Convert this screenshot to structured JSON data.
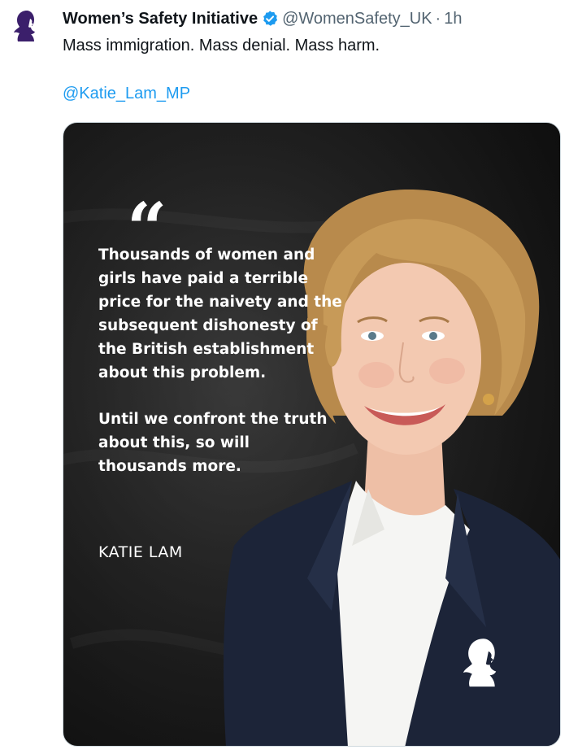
{
  "tweet": {
    "author": {
      "display_name": "Women’s Safety Initiative",
      "handle": "@WomenSafety_UK",
      "verified": true,
      "avatar_icon": "silhouette-woman-icon"
    },
    "separator": "·",
    "time": "1h",
    "text": "Mass immigration. Mass denial. Mass harm.",
    "mention": "@Katie_Lam_MP"
  },
  "media": {
    "quote_mark": "“",
    "quote_paragraphs": [
      "Thousands of women and girls have paid a terrible price for the naivety and the subsequent dishonesty of the British establishment about this problem.",
      "Until we confront the truth about this, so will thousands more."
    ],
    "attribution": "KATIE LAM",
    "logo_icon": "silhouette-woman-icon"
  },
  "colors": {
    "accent": "#1d9bf0",
    "text_primary": "#0f1419",
    "text_secondary": "#536471",
    "avatar_purple": "#3b1f6b",
    "media_background": "#262626"
  }
}
